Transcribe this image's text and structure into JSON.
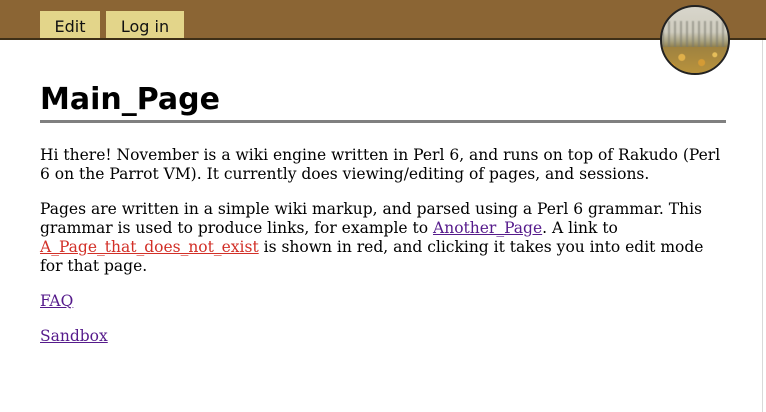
{
  "header": {
    "tabs": [
      {
        "label": "Edit"
      },
      {
        "label": "Log in"
      }
    ],
    "logo_icon": "forest-logo-icon"
  },
  "main": {
    "title": "Main_Page",
    "paragraph1": "Hi there! November is a wiki engine written in Perl 6, and runs on top of Rakudo (Perl 6 on the Parrot VM). It currently does viewing/editing of pages, and sessions.",
    "paragraph2": {
      "text_before_link1": "Pages are written in a simple wiki markup, and parsed using a Perl 6 grammar. This grammar is used to produce links, for example to ",
      "link1": "Another_Page",
      "text_between": ". A link to ",
      "link2": "A_Page_that_does_not_exist",
      "text_after": " is shown in red, and clicking it takes you into edit mode for that page."
    },
    "links": [
      {
        "label": "FAQ"
      },
      {
        "label": "Sandbox"
      }
    ]
  },
  "colors": {
    "header_bg": "#8b6534",
    "tab_bg": "#e3d58a",
    "link_existing": "#551a8b",
    "link_missing": "#d22f27"
  }
}
